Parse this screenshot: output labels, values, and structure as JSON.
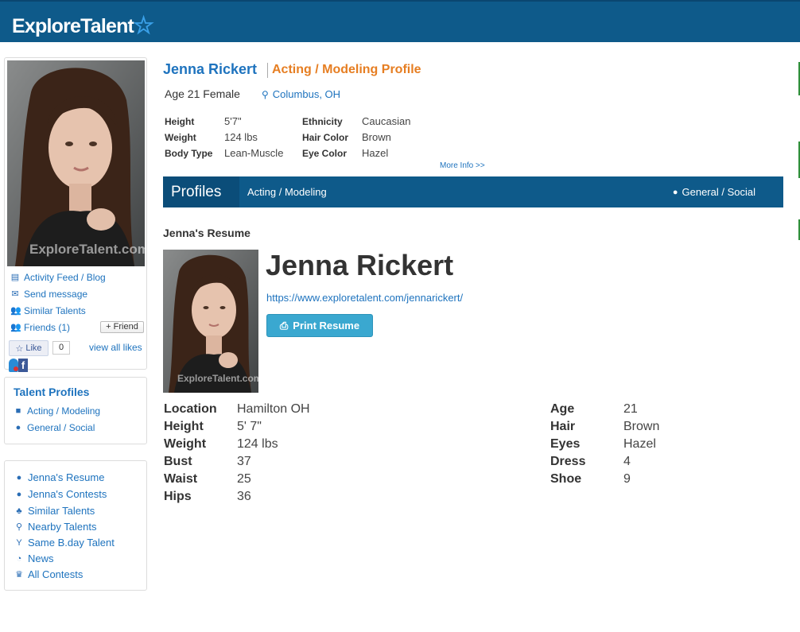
{
  "brand": {
    "name": "ExploreTalent",
    "star": "☆"
  },
  "sidebar": {
    "photo_watermark": "ExploreTalent.com",
    "links": [
      {
        "label": "Activity Feed / Blog",
        "icon": "feed-icon"
      },
      {
        "label": "Send message",
        "icon": "envelope-icon"
      },
      {
        "label": "Similar Talents",
        "icon": "users-icon"
      },
      {
        "label": "Friends (1)",
        "icon": "users-icon"
      }
    ],
    "friend_button": "+ Friend",
    "like_label": "Like",
    "like_count": "0",
    "view_all_likes": "view all likes",
    "talent_profiles_title": "Talent Profiles",
    "talent_profiles": [
      {
        "label": "Acting / Modeling",
        "icon": "video-camera-icon"
      },
      {
        "label": "General / Social",
        "icon": "user-icon"
      }
    ],
    "nav": [
      {
        "label": "Jenna's Resume",
        "icon": "user-icon"
      },
      {
        "label": "Jenna's Contests",
        "icon": "user-icon"
      },
      {
        "label": "Similar Talents",
        "icon": "sitemap-icon"
      },
      {
        "label": "Nearby Talents",
        "icon": "map-marker-icon"
      },
      {
        "label": "Same B.day Talent",
        "icon": "glass-icon"
      },
      {
        "label": "News",
        "icon": "rss-icon"
      },
      {
        "label": "All Contests",
        "icon": "trophy-icon"
      }
    ]
  },
  "header": {
    "name": "Jenna Rickert",
    "profile_type": "Acting / Modeling Profile",
    "age_gender": "Age 21 Female",
    "location": "Columbus, OH"
  },
  "stats": {
    "height_label": "Height",
    "height": "5'7\"",
    "weight_label": "Weight",
    "weight": "124 lbs",
    "body_type_label": "Body Type",
    "body_type": "Lean-Muscle",
    "ethnicity_label": "Ethnicity",
    "ethnicity": "Caucasian",
    "hair_label": "Hair Color",
    "hair": "Brown",
    "eye_label": "Eye Color",
    "eye": "Hazel",
    "more_info": "More Info >>"
  },
  "profiles_bar": {
    "title": "Profiles",
    "left_link": "Acting / Modeling",
    "right_link": "General / Social"
  },
  "resume": {
    "heading": "Jenna's Resume",
    "name": "Jenna Rickert",
    "url": "https://www.exploretalent.com/jennarickert/",
    "print_button": "Print Resume",
    "photo_watermark": "ExploreTalent.com",
    "left": [
      {
        "label": "Location",
        "value": "Hamilton OH"
      },
      {
        "label": "Height",
        "value": "5' 7\""
      },
      {
        "label": "Weight",
        "value": "124 lbs"
      },
      {
        "label": "Bust",
        "value": "37"
      },
      {
        "label": "Waist",
        "value": "25"
      },
      {
        "label": "Hips",
        "value": "36"
      }
    ],
    "right": [
      {
        "label": "Age",
        "value": "21"
      },
      {
        "label": "Hair",
        "value": "Brown"
      },
      {
        "label": "Eyes",
        "value": "Hazel"
      },
      {
        "label": "Dress",
        "value": "4"
      },
      {
        "label": "Shoe",
        "value": "9"
      }
    ]
  }
}
